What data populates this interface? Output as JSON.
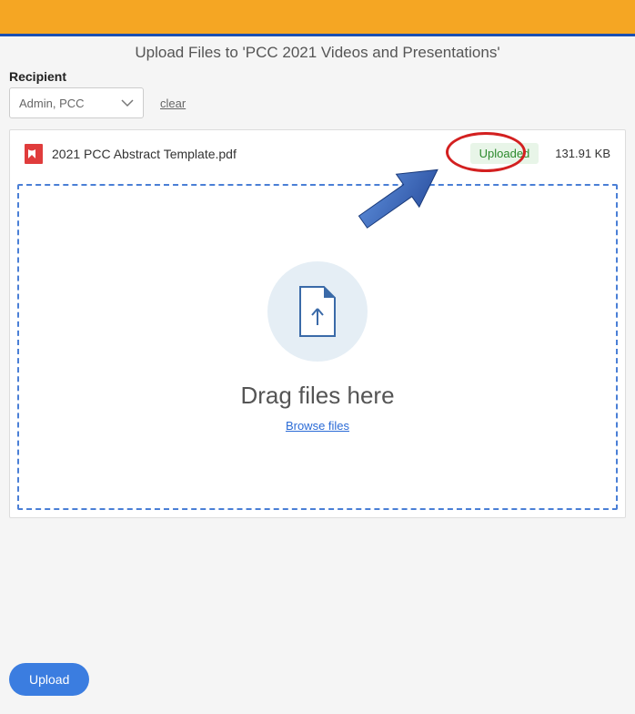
{
  "header": {
    "title": "Upload Files to 'PCC 2021 Videos and Presentations'"
  },
  "recipient": {
    "label": "Recipient",
    "selected": "Admin, PCC",
    "clear_label": "clear"
  },
  "file": {
    "name": "2021 PCC Abstract Template.pdf",
    "status": "Uploaded",
    "size": "131.91 KB"
  },
  "dropzone": {
    "drag_text": "Drag files here",
    "browse_label": "Browse files"
  },
  "actions": {
    "upload_label": "Upload"
  }
}
